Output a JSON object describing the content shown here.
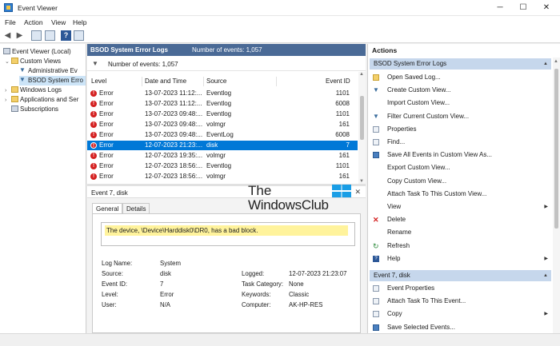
{
  "window": {
    "title": "Event Viewer",
    "minimize": "─",
    "maximize": "☐",
    "close": "✕"
  },
  "menu": [
    "File",
    "Action",
    "View",
    "Help"
  ],
  "toolbar": {
    "back": "◀",
    "forward": "▶",
    "help": "?"
  },
  "tree": {
    "root": "Event Viewer (Local)",
    "custom_views": "Custom Views",
    "admin_events": "Administrative Ev",
    "bsod_view": "BSOD System Erro",
    "windows_logs": "Windows Logs",
    "apps_services": "Applications and Ser",
    "subscriptions": "Subscriptions",
    "expanded_glyph": "⌄",
    "collapsed_glyph": "›"
  },
  "center": {
    "header_name": "BSOD System Error Logs",
    "header_count": "Number of events: 1,057",
    "filter_text": "Number of events: 1,057",
    "columns": [
      "Level",
      "Date and Time",
      "Source",
      "Event ID"
    ],
    "events": [
      {
        "level": "Error",
        "datetime": "13-07-2023 11:12:...",
        "source": "Eventlog",
        "id": "1101"
      },
      {
        "level": "Error",
        "datetime": "13-07-2023 11:12:...",
        "source": "Eventlog",
        "id": "6008"
      },
      {
        "level": "Error",
        "datetime": "13-07-2023 09:48:...",
        "source": "Eventlog",
        "id": "1101"
      },
      {
        "level": "Error",
        "datetime": "13-07-2023 09:48:...",
        "source": "volmgr",
        "id": "161"
      },
      {
        "level": "Error",
        "datetime": "13-07-2023 09:48:...",
        "source": "EventLog",
        "id": "6008"
      },
      {
        "level": "Error",
        "datetime": "12-07-2023 21:23:...",
        "source": "disk",
        "id": "7"
      },
      {
        "level": "Error",
        "datetime": "12-07-2023 19:35:...",
        "source": "volmgr",
        "id": "161"
      },
      {
        "level": "Error",
        "datetime": "12-07-2023 18:56:...",
        "source": "Eventlog",
        "id": "1101"
      },
      {
        "level": "Error",
        "datetime": "12-07-2023 18:56:...",
        "source": "volmgr",
        "id": "161"
      }
    ],
    "selected_index": 5
  },
  "detail": {
    "title": "Event 7, disk",
    "close": "✕",
    "tabs": [
      "General",
      "Details"
    ],
    "message": "The device, \\Device\\Harddisk0\\DR0, has a bad block.",
    "fields": {
      "log_name_label": "Log Name:",
      "log_name": "System",
      "source_label": "Source:",
      "source": "disk",
      "logged_label": "Logged:",
      "logged": "12-07-2023 21:23:07",
      "event_id_label": "Event ID:",
      "event_id": "7",
      "task_label": "Task Category:",
      "task": "None",
      "level_label": "Level:",
      "level": "Error",
      "keywords_label": "Keywords:",
      "keywords": "Classic",
      "user_label": "User:",
      "user": "N/A",
      "computer_label": "Computer:",
      "computer": "AK-HP-RES"
    }
  },
  "watermark": {
    "line1": "The",
    "line2": "WindowsClub"
  },
  "actions": {
    "header": "Actions",
    "section1": "BSOD System Error Logs",
    "items1": [
      {
        "label": "Open Saved Log...",
        "icon": "folder-open-icon"
      },
      {
        "label": "Create Custom View...",
        "icon": "filter-icon"
      },
      {
        "label": "Import Custom View...",
        "icon": ""
      },
      {
        "label": "Filter Current Custom View...",
        "icon": "filter-icon"
      },
      {
        "label": "Properties",
        "icon": "properties-icon"
      },
      {
        "label": "Find...",
        "icon": "find-icon"
      },
      {
        "label": "Save All Events in Custom View As...",
        "icon": "save-icon"
      },
      {
        "label": "Export Custom View...",
        "icon": ""
      },
      {
        "label": "Copy Custom View...",
        "icon": ""
      },
      {
        "label": "Attach Task To This Custom View...",
        "icon": ""
      },
      {
        "label": "View",
        "icon": ""
      },
      {
        "label": "Delete",
        "icon": "delete-icon"
      },
      {
        "label": "Rename",
        "icon": ""
      },
      {
        "label": "Refresh",
        "icon": "refresh-icon"
      },
      {
        "label": "Help",
        "icon": "help-icon"
      }
    ],
    "section2": "Event 7, disk",
    "items2": [
      {
        "label": "Event Properties",
        "icon": "properties-icon"
      },
      {
        "label": "Attach Task To This Event...",
        "icon": "task-icon"
      },
      {
        "label": "Copy",
        "icon": "copy-icon"
      },
      {
        "label": "Save Selected Events...",
        "icon": "save-icon"
      }
    ],
    "submenu_glyph": "▶",
    "collapse_glyph": "▲"
  }
}
